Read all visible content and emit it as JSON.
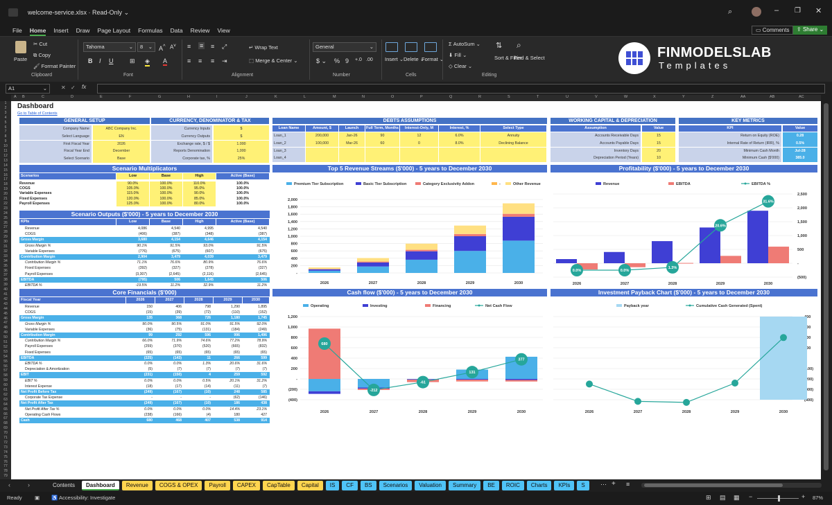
{
  "window": {
    "filename": "welcome-service.xlsx",
    "mode": "Read-Only"
  },
  "menu": [
    "File",
    "Home",
    "Insert",
    "Draw",
    "Page Layout",
    "Formulas",
    "Data",
    "Review",
    "View"
  ],
  "menu_active": "Home",
  "comments_label": "Comments",
  "share_label": "Share",
  "ribbon": {
    "paste": "Paste",
    "cut": "Cut",
    "copy": "Copy",
    "format_painter": "Format Painter",
    "clipboard": "Clipboard",
    "font_name": "Tahoma",
    "font_size": "8",
    "font_group": "Font",
    "wrap_text": "Wrap Text",
    "merge_center": "Merge & Center",
    "alignment": "Alignment",
    "number_format": "General",
    "number": "Number",
    "insert": "Insert",
    "delete": "Delete",
    "format": "Format",
    "cells": "Cells",
    "autosum": "AutoSum",
    "fill": "Fill",
    "clear": "Clear",
    "sort_filter": "Sort & Filter",
    "find_select": "Find & Select",
    "editing": "Editing",
    "brand_name": "FINMODELSLAB",
    "brand_sub": "Templates"
  },
  "formula": {
    "cell_ref": "A1",
    "fx": "fx",
    "content": ""
  },
  "columns": [
    "A",
    "B",
    "C",
    "D",
    "E",
    "F",
    "G",
    "H",
    "I",
    "J",
    "K",
    "L",
    "M",
    "N",
    "O",
    "P",
    "Q",
    "R",
    "S",
    "T",
    "U",
    "V",
    "W",
    "X",
    "Y",
    "Z",
    "AA",
    "AB",
    "AC",
    "AD"
  ],
  "rows": [
    "1",
    "2",
    "3",
    "4",
    "5",
    "6",
    "7",
    "8",
    "9",
    "10",
    "11",
    "12",
    "13",
    "14",
    "15",
    "16",
    "17",
    "18",
    "19",
    "20",
    "21",
    "22",
    "23",
    "24",
    "25",
    "26",
    "27",
    "28",
    "29",
    "30",
    "31",
    "32",
    "33",
    "34",
    "35",
    "36",
    "37",
    "38",
    "39",
    "40",
    "41",
    "42",
    "43",
    "44",
    "45",
    "46",
    "47",
    "48",
    "49",
    "50",
    "51",
    "52",
    "53",
    "54",
    "55",
    "56",
    "57",
    "58",
    "59",
    "60",
    "61",
    "62",
    "63",
    "64",
    "65",
    "66",
    "67",
    "68",
    "69",
    "70",
    "71",
    "72",
    "73",
    "74",
    "75",
    "76",
    "77",
    "78",
    "79"
  ],
  "sheet": {
    "title": "Dashboard",
    "toc_link": "Go to Table of Contents",
    "general_setup": {
      "title": "GENERAL SETUP",
      "rows": [
        [
          "Company Name",
          "ABC Company Inc."
        ],
        [
          "Select Language",
          "EN"
        ],
        [
          "First Fiscal Year",
          "2026"
        ],
        [
          "Fiscal Year End",
          "December"
        ],
        [
          "Select Scenario",
          "Base"
        ]
      ]
    },
    "currency": {
      "title": "CURRENCY, DENOMINATOR & TAX",
      "rows": [
        [
          "Currency Inputs",
          "$"
        ],
        [
          "Currency Outputs",
          "$"
        ],
        [
          "Exchange rate, $ / $",
          "1.000"
        ],
        [
          "Reports Denomination",
          "1,000"
        ],
        [
          "Corporate tax, %",
          "25%"
        ]
      ]
    },
    "debts": {
      "title": "DEBTS ASSUMPTIONS",
      "headers": [
        "Loan Name",
        "Amount, $",
        "Launch",
        "Full Term, Months",
        "Interest-Only, M",
        "Interest, %",
        "Select Type"
      ],
      "rows": [
        [
          "Loan_1",
          "200,000",
          "Jan-26",
          "90",
          "12",
          "6.0%",
          "Annuity"
        ],
        [
          "Loan_2",
          "100,000",
          "Mar-26",
          "60",
          "0",
          "8.0%",
          "Declining Balance"
        ],
        [
          "Loan_3",
          "",
          "",
          "",
          "",
          "",
          ""
        ],
        [
          "Loan_4",
          "",
          "",
          "",
          "",
          "",
          ""
        ]
      ]
    },
    "working_capital": {
      "title": "WORKING CAPITAL & DEPRECIATION",
      "headers": [
        "Assumption",
        "Value"
      ],
      "rows": [
        [
          "Accounts Receivable Days",
          "15"
        ],
        [
          "Accounts Payable Days",
          "15"
        ],
        [
          "Inventory Days",
          "20"
        ],
        [
          "Depreciation Period (Years)",
          "10"
        ]
      ]
    },
    "key_metrics": {
      "title": "KEY METRICS",
      "headers": [
        "KPI",
        "Value"
      ],
      "rows": [
        [
          "Return on Equity (ROE)",
          "0.28"
        ],
        [
          "Internal Rate of Return (IRR), %",
          "0.5%"
        ],
        [
          "Minimum Cash Month",
          "Jul-28"
        ],
        [
          "Minimum Cash ($'000)",
          "385.0"
        ]
      ]
    },
    "scenario_mult": {
      "title": "Scenario Multiplicators",
      "headers": [
        "Scenarios",
        "Low",
        "Base",
        "High",
        "Active (Base)"
      ],
      "rows": [
        [
          "Revenue",
          "90.0%",
          "100.0%",
          "110.0%",
          "100.0%"
        ],
        [
          "COGS",
          "105.0%",
          "100.0%",
          "95.0%",
          "100.0%"
        ],
        [
          "Variable Expenses",
          "115.0%",
          "100.0%",
          "90.0%",
          "100.0%"
        ],
        [
          "Fixed Expenses",
          "120.0%",
          "100.0%",
          "85.0%",
          "100.0%"
        ],
        [
          "Payroll Expenses",
          "125.0%",
          "100.0%",
          "80.0%",
          "100.0%"
        ]
      ]
    },
    "scenario_out": {
      "title": "Scenario Outputs ($'000) - 5 years to December 2030",
      "headers": [
        "KPIs",
        "Low",
        "Base",
        "High",
        "Active (Base)"
      ],
      "rows": [
        {
          "l": "Revenue",
          "v": [
            "4,086",
            "4,540",
            "4,995",
            "4,540"
          ],
          "s": ""
        },
        {
          "l": "COGS",
          "v": [
            "(406)",
            "(387)",
            "(348)",
            "(387)"
          ],
          "s": ""
        },
        {
          "l": "Gross Margin",
          "v": [
            "3,680",
            "4,154",
            "4,646",
            "4,154"
          ],
          "s": "hl"
        },
        {
          "l": "Gross Margin %",
          "v": [
            "90.1%",
            "91.5%",
            "93.0%",
            "91.5%"
          ],
          "s": "it"
        },
        {
          "l": "Variable Expenses",
          "v": [
            "(776)",
            "(675)",
            "(607)",
            "(675)"
          ],
          "s": ""
        },
        {
          "l": "Contribution Margin",
          "v": [
            "2,904",
            "3,479",
            "4,039",
            "3,479"
          ],
          "s": "hl"
        },
        {
          "l": "Contribution Margin %",
          "v": [
            "71.1%",
            "76.6%",
            "80.9%",
            "76.6%"
          ],
          "s": "it"
        },
        {
          "l": "Fixed Expenses",
          "v": [
            "(392)",
            "(327)",
            "(278)",
            "(327)"
          ],
          "s": ""
        },
        {
          "l": "Payroll Expenses",
          "v": [
            "(3,307)",
            "(2,645)",
            "(2,116)",
            "(2,645)"
          ],
          "s": ""
        },
        {
          "l": "EBITDA",
          "v": [
            "(795)",
            "506",
            "1,645",
            "506"
          ],
          "s": "hl"
        },
        {
          "l": "EBITDA %",
          "v": [
            "-19.5%",
            "11.2%",
            "32.9%",
            "11.2%"
          ],
          "s": "it"
        }
      ]
    },
    "core": {
      "title": "Core Financials ($'000)",
      "headers": [
        "Fiscal Year",
        "2026",
        "2027",
        "2028",
        "2029",
        "2030"
      ],
      "rows": [
        {
          "l": "Revenue",
          "v": [
            "150",
            "406",
            "798",
            "1,290",
            "1,895"
          ],
          "s": ""
        },
        {
          "l": "COGS",
          "v": [
            "(15)",
            "(39)",
            "(72)",
            "(110)",
            "(152)"
          ],
          "s": ""
        },
        {
          "l": "Gross Margin",
          "v": [
            "135",
            "368",
            "726",
            "1,180",
            "1,745"
          ],
          "s": "hl"
        },
        {
          "l": "Gross Margin %",
          "v": [
            "90.0%",
            "90.5%",
            "91.0%",
            "91.5%",
            "92.0%"
          ],
          "s": "it"
        },
        {
          "l": "Variable Expenses",
          "v": [
            "(36)",
            "(75)",
            "(131)",
            "(184)",
            "(249)"
          ],
          "s": ""
        },
        {
          "l": "Contribution Margin",
          "v": [
            "99",
            "292",
            "596",
            "996",
            "1,496"
          ],
          "s": "hl"
        },
        {
          "l": "Contribution Margin %",
          "v": [
            "66.0%",
            "71.9%",
            "74.6%",
            "77.2%",
            "78.9%"
          ],
          "s": "it"
        },
        {
          "l": "Payroll Expenses",
          "v": [
            "(259)",
            "(370)",
            "(520)",
            "(665)",
            "(832)"
          ],
          "s": ""
        },
        {
          "l": "Fixed Expenses",
          "v": [
            "(65)",
            "(65)",
            "(65)",
            "(65)",
            "(65)"
          ],
          "s": ""
        },
        {
          "l": "EBITDA",
          "v": [
            "(225)",
            "(143)",
            "11",
            "266",
            "599"
          ],
          "s": "hl"
        },
        {
          "l": "EBITDA %",
          "v": [
            "0.0%",
            "0.0%",
            "1.3%",
            "20.6%",
            "31.6%"
          ],
          "s": "it"
        },
        {
          "l": "Depreciation & Amortization",
          "v": [
            "(5)",
            "(7)",
            "(7)",
            "(7)",
            "(7)"
          ],
          "s": ""
        },
        {
          "l": "EBIT",
          "v": [
            "(231)",
            "(150)",
            "4",
            "259",
            "592"
          ],
          "s": "hl"
        },
        {
          "l": "EBIT %",
          "v": [
            "0.0%",
            "0.0%",
            "0.5%",
            "20.1%",
            "31.2%"
          ],
          "s": "it"
        },
        {
          "l": "Interest Expense",
          "v": [
            "(18)",
            "(17)",
            "(14)",
            "(11)",
            "(7)"
          ],
          "s": ""
        },
        {
          "l": "Net Profit Before Tax",
          "v": [
            "(249)",
            "(167)",
            "(10)",
            "248",
            "585"
          ],
          "s": "hl"
        },
        {
          "l": "Corporate Tax Expense",
          "v": [
            "-",
            "-",
            "-",
            "(62)",
            "(146)"
          ],
          "s": ""
        },
        {
          "l": "Net Profit After Tax",
          "v": [
            "(249)",
            "(167)",
            "(10)",
            "186",
            "438"
          ],
          "s": "hl"
        },
        {
          "l": "Net Profit After Tax %",
          "v": [
            "0.0%",
            "0.0%",
            "0.0%",
            "14.4%",
            "23.1%"
          ],
          "s": "it"
        },
        {
          "l": "Operating Cash Flows",
          "v": [
            "(238)",
            "(166)",
            "(4)",
            "180",
            "427"
          ],
          "s": ""
        },
        {
          "l": "Cash",
          "v": [
            "680",
            "468",
            "407",
            "538",
            "914"
          ],
          "s": "hl"
        }
      ]
    }
  },
  "chart_data": [
    {
      "type": "bar",
      "title": "Top 5 Revenue Streams ($'000) - 5 years to December 2030",
      "categories": [
        "2026",
        "2027",
        "2028",
        "2029",
        "2030"
      ],
      "yticks": [
        "-",
        "200",
        "400",
        "600",
        "800",
        "1,000",
        "1,200",
        "1,400",
        "1,600",
        "1,800",
        "2,000"
      ],
      "ylim": [
        0,
        2000
      ],
      "series": [
        {
          "name": "Premium Tier Subscription",
          "color": "#4ab0e8",
          "values": [
            60,
            175,
            360,
            600,
            880
          ]
        },
        {
          "name": "Basic Tier Subscription",
          "color": "#3f3fd4",
          "values": [
            40,
            110,
            230,
            400,
            650
          ]
        },
        {
          "name": "Category Exclusivity Addon",
          "color": "#ef7b75",
          "values": [
            10,
            25,
            40,
            60,
            80
          ]
        },
        {
          "name": "-",
          "color": "#ffb74d",
          "values": [
            0,
            0,
            0,
            0,
            0
          ]
        },
        {
          "name": "Other Revenue",
          "color": "#ffe082",
          "values": [
            40,
            96,
            168,
            230,
            285
          ]
        }
      ]
    },
    {
      "type": "bar+line",
      "title": "Profitability ($'000) - 5 years to December 2030",
      "categories": [
        "2026",
        "2027",
        "2028",
        "2029",
        "2030"
      ],
      "yticks": [
        "(500)",
        "-",
        "500",
        "1,000",
        "1,500",
        "2,000",
        "2,500"
      ],
      "ylim": [
        -500,
        2500
      ],
      "series": [
        {
          "name": "Revenue",
          "color": "#3f3fd4",
          "values": [
            150,
            406,
            798,
            1290,
            1895
          ]
        },
        {
          "name": "EBITDA",
          "color": "#ef7b75",
          "values": [
            -225,
            -143,
            11,
            266,
            599
          ]
        },
        {
          "name": "EBITDA %",
          "color": "#26a69a",
          "values": [
            0.0,
            0.0,
            1.3,
            20.6,
            31.6
          ]
        }
      ],
      "point_labels": [
        "0.0%",
        "0.0%",
        "1.3%",
        "20.6%",
        "31.6%"
      ]
    },
    {
      "type": "bar+line",
      "title": "Cash flow ($'000) - 5 years to December 2030",
      "categories": [
        "2026",
        "2027",
        "2028",
        "2029",
        "2030"
      ],
      "yticks": [
        "(400)",
        "(200)",
        "-",
        "200",
        "400",
        "600",
        "800",
        "1,000",
        "1,200"
      ],
      "ylim": [
        -400,
        1200
      ],
      "series": [
        {
          "name": "Operating",
          "color": "#4ab0e8",
          "values": [
            -238,
            -166,
            -4,
            180,
            427
          ]
        },
        {
          "name": "Investing",
          "color": "#3f3fd4",
          "values": [
            -50,
            -20,
            -10,
            -15,
            -20
          ]
        },
        {
          "name": "Financing",
          "color": "#ef7b75",
          "values": [
            968,
            -26,
            -47,
            -34,
            -30
          ]
        },
        {
          "name": "Net Cash Flow",
          "color": "#26a69a",
          "values": [
            680,
            -212,
            -61,
            131,
            377
          ]
        }
      ],
      "point_labels": [
        "680",
        "-212",
        "-61",
        "131",
        "377"
      ]
    },
    {
      "type": "bar+line",
      "title": "Investment Payback Chart ($'000) - 5 years to December 2030",
      "categories": [
        "2026",
        "2027",
        "2028",
        "2029",
        "2030"
      ],
      "yticks": [
        "(400)",
        "(300)",
        "(200)",
        "(100)",
        "-",
        "100",
        "200",
        "300",
        "400"
      ],
      "ylim": [
        -400,
        400
      ],
      "series": [
        {
          "name": "Payback year",
          "color": "#a6d8f2",
          "values": [
            0,
            0,
            0,
            0,
            1
          ]
        },
        {
          "name": "Cumulative Cash Generated (Spent)",
          "color": "#26a69a",
          "values": [
            -249,
            -416,
            -426,
            -240,
            198
          ]
        }
      ]
    }
  ],
  "tabs": [
    {
      "label": "Contents",
      "style": "plain"
    },
    {
      "label": "Dashboard",
      "style": "act"
    },
    {
      "label": "Revenue",
      "style": "y"
    },
    {
      "label": "COGS & OPEX",
      "style": "y"
    },
    {
      "label": "Payroll",
      "style": "y"
    },
    {
      "label": "CAPEX",
      "style": "y"
    },
    {
      "label": "CapTable",
      "style": "y"
    },
    {
      "label": "Capital",
      "style": "y"
    },
    {
      "label": "IS",
      "style": "b"
    },
    {
      "label": "CF",
      "style": "b"
    },
    {
      "label": "BS",
      "style": "b"
    },
    {
      "label": "Scenarios",
      "style": "b"
    },
    {
      "label": "Valuation",
      "style": "b"
    },
    {
      "label": "Summary",
      "style": "b"
    },
    {
      "label": "BE",
      "style": "b"
    },
    {
      "label": "ROIC",
      "style": "b"
    },
    {
      "label": "Charts",
      "style": "b"
    },
    {
      "label": "KPIs",
      "style": "b"
    },
    {
      "label": "S",
      "style": "b"
    }
  ],
  "status": {
    "ready": "Ready",
    "accessibility": "Accessibility: Investigate",
    "zoom": "87%"
  }
}
